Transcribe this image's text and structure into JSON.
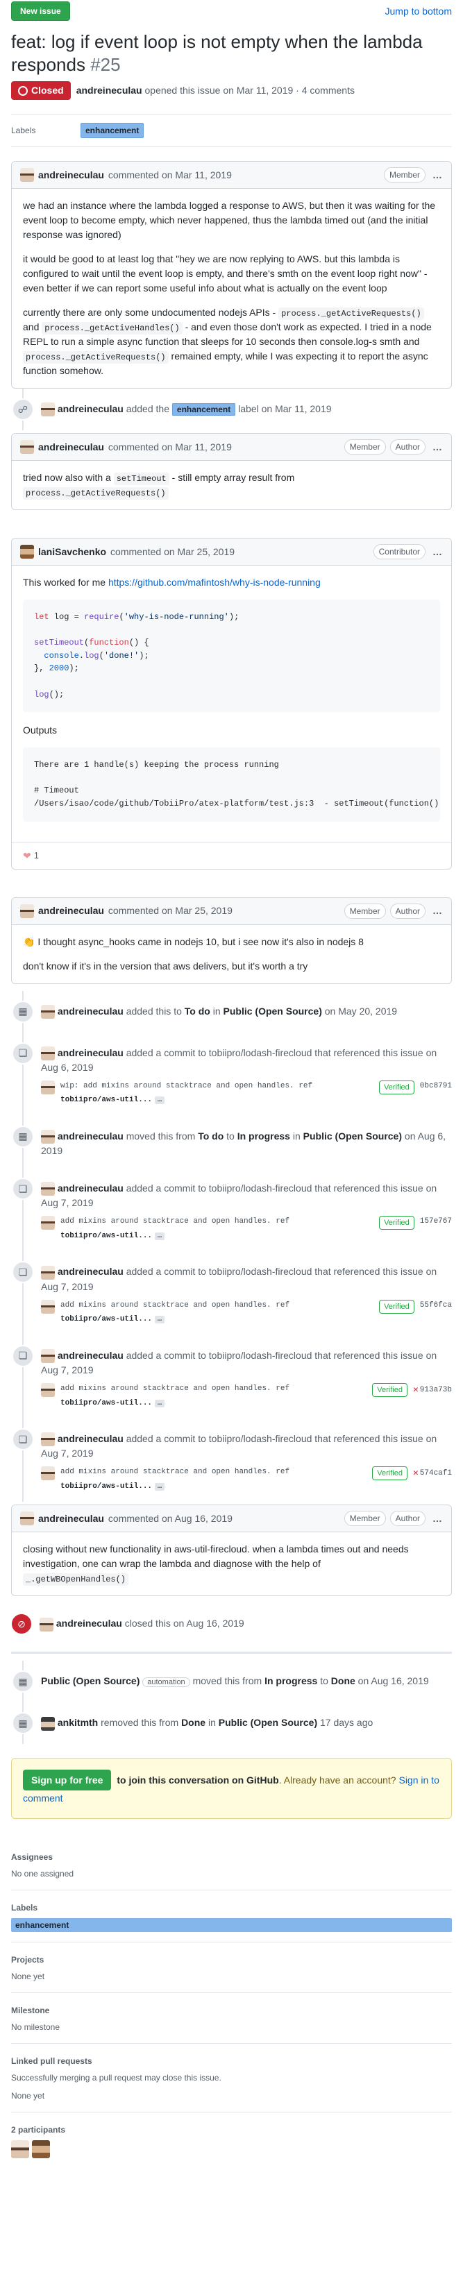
{
  "top": {
    "new_issue": "New issue",
    "jump": "Jump to bottom"
  },
  "issue": {
    "title": "feat: log if event loop is not empty when the lambda responds",
    "number": "#25",
    "state": "Closed",
    "author": "andreineculau",
    "meta_rest": "opened this issue on Mar 11, 2019 · 4 comments"
  },
  "labels_row": {
    "heading": "Labels",
    "label": "enhancement"
  },
  "comments": [
    {
      "author": "andreineculau",
      "when": "commented on Mar 11, 2019",
      "roles": [
        "Member"
      ],
      "p1": "we had an instance where the lambda logged a response to AWS, but then it was waiting for the event loop to become empty, which never happened, thus the lambda timed out (and the initial response was ignored)",
      "p2": "it would be good to at least log that \"hey we are now replying to AWS. but this lambda is configured to wait until the event loop is empty, and there's smth on the event loop right now\" - even better if we can report some useful info about what is actually on the event loop",
      "p3a": "currently there are only some undocumented nodejs APIs -",
      "p3code1": "process._getActiveRequests()",
      "p3and": "and",
      "p3code2": "process._getActiveHandles()",
      "p3b": "- and even those don't work as expected. I tried in a node REPL to run a simple async function that sleeps for 10 seconds then console.log-s smth and",
      "p3code3": "process._getActiveRequests()",
      "p3c": "remained empty, while I was expecting it to report the async function somehow."
    },
    {
      "author": "andreineculau",
      "when": "commented on Mar 11, 2019",
      "roles": [
        "Member",
        "Author"
      ],
      "p1a": "tried now also with a",
      "p1code": "setTimeout",
      "p1b": "- still empty array result from",
      "p1code2": "process._getActiveRequests()"
    },
    {
      "author": "laniSavchenko",
      "when": "commented on Mar 25, 2019",
      "roles": [
        "Contributor"
      ],
      "p1": "This worked for me",
      "link": "https://github.com/mafintosh/why-is-node-running",
      "outputs": "Outputs",
      "out1": "There are 1 handle(s) keeping the process running",
      "out2": "# Timeout",
      "out3": "/Users/isao/code/github/TobiiPro/atex-platform/test.js:3  - setTimeout(function() {",
      "reaction_count": "1"
    },
    {
      "author": "andreineculau",
      "when": "commented on Mar 25, 2019",
      "roles": [
        "Member",
        "Author"
      ],
      "p1": "I thought async_hooks came in nodejs 10, but i see now it's also in nodejs 8",
      "p2": "don't know if it's in the version that aws delivers, but it's worth a try"
    },
    {
      "author": "andreineculau",
      "when": "commented on Aug 16, 2019",
      "roles": [
        "Member",
        "Author"
      ],
      "p1": "closing without new functionality in aws-util-firecloud. when a lambda times out and needs investigation, one can wrap the lambda and diagnose with the help of",
      "p1code": "_.getWBOpenHandles()"
    }
  ],
  "events": {
    "label_added": {
      "actor": "andreineculau",
      "a": "added the",
      "label": "enhancement",
      "b": "label on Mar 11, 2019"
    },
    "todo": {
      "actor": "andreineculau",
      "a": "added this to",
      "col": "To do",
      "in": "in",
      "proj": "Public (Open Source)",
      "b": "on May 20, 2019"
    },
    "commits": [
      {
        "actor": "andreineculau",
        "text": "added a commit to tobiipro/lodash-firecloud that referenced this issue",
        "date": "on Aug 6, 2019",
        "msg": "wip: add mixins around stacktrace and open handles. ref",
        "repo": "tobiipro/aws-util...",
        "verified": "Verified",
        "sha": "0bc8791",
        "x": false
      },
      {
        "actor": "andreineculau",
        "text": "added a commit to tobiipro/lodash-firecloud that referenced this issue",
        "date": "on Aug 7, 2019",
        "msg": "add mixins around stacktrace and open handles. ref",
        "repo": "tobiipro/aws-util...",
        "verified": "Verified",
        "sha": "157e767",
        "x": false
      },
      {
        "actor": "andreineculau",
        "text": "added a commit to tobiipro/lodash-firecloud that referenced this issue",
        "date": "on Aug 7, 2019",
        "msg": "add mixins around stacktrace and open handles. ref",
        "repo": "tobiipro/aws-util...",
        "verified": "Verified",
        "sha": "55f6fca",
        "x": false
      },
      {
        "actor": "andreineculau",
        "text": "added a commit to tobiipro/lodash-firecloud that referenced this issue",
        "date": "on Aug 7, 2019",
        "msg": "add mixins around stacktrace and open handles. ref",
        "repo": "tobiipro/aws-util...",
        "verified": "Verified",
        "sha": "913a73b",
        "x": true
      },
      {
        "actor": "andreineculau",
        "text": "added a commit to tobiipro/lodash-firecloud that referenced this issue",
        "date": "on Aug 7, 2019",
        "msg": "add mixins around stacktrace and open handles. ref",
        "repo": "tobiipro/aws-util...",
        "verified": "Verified",
        "sha": "574caf1",
        "x": true
      }
    ],
    "moved": {
      "actor": "andreineculau",
      "a": "moved this from",
      "from": "To do",
      "to_word": "to",
      "to": "In progress",
      "in": "in",
      "proj": "Public (Open Source)",
      "b": "on Aug 6, 2019"
    },
    "closed": {
      "actor": "andreineculau",
      "b": "closed this on Aug 16, 2019"
    },
    "auto_moved": {
      "actor": "Public (Open Source)",
      "badge": "automation",
      "a": "moved this from",
      "from": "In progress",
      "to_word": "to",
      "to": "Done",
      "b": "on Aug 16, 2019"
    },
    "removed": {
      "actor": "ankitmth",
      "a": "removed this from",
      "from": "Done",
      "in": "in",
      "proj": "Public (Open Source)",
      "b": "17 days ago"
    }
  },
  "ellipsis": "…",
  "signup": {
    "button": "Sign up for free",
    "text1": "to join this conversation on GitHub",
    "text2": ". Already have an account?",
    "signin": "Sign in to comment"
  },
  "sidebar": {
    "assignees_h": "Assignees",
    "assignees_v": "No one assigned",
    "labels_h": "Labels",
    "labels_v": "enhancement",
    "projects_h": "Projects",
    "projects_v": "None yet",
    "milestone_h": "Milestone",
    "milestone_v": "No milestone",
    "linked_h": "Linked pull requests",
    "linked_desc": "Successfully merging a pull request may close this issue.",
    "linked_v": "None yet",
    "participants_h": "2 participants"
  },
  "colors": {
    "green": "#2ea44f",
    "closed_red": "#cb2431",
    "label_bg": "#84b6eb",
    "link": "#0366d6"
  }
}
